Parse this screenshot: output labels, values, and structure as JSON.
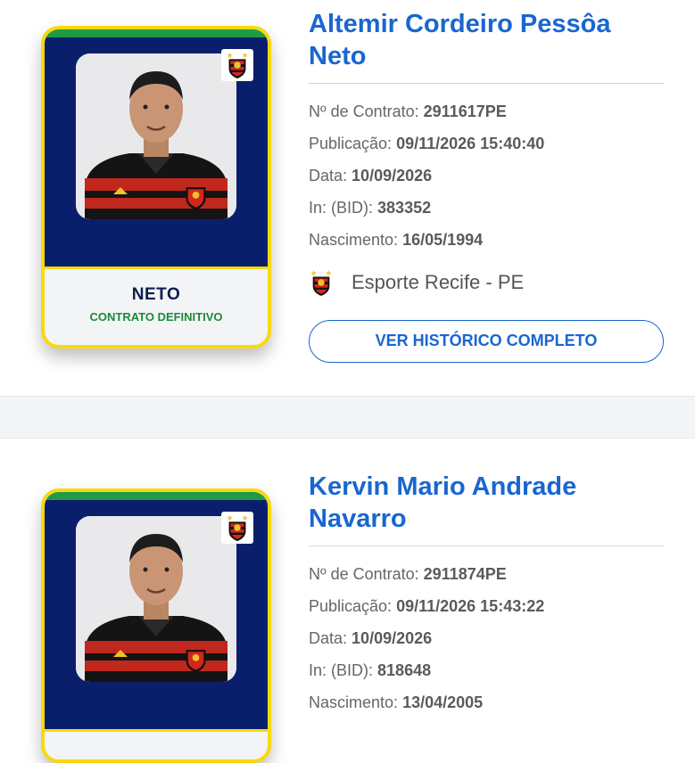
{
  "players": [
    {
      "full_name_line1": "Altemir Cordeiro Pessôa",
      "full_name_line2": "Neto",
      "nickname": "NETO",
      "contract_type": "CONTRATO DEFINITIVO",
      "contract_label": "Nº de Contrato:",
      "contract_value": "2911617PE",
      "publication_label": "Publicação:",
      "publication_value": "09/11/2026 15:40:40",
      "date_label": "Data:",
      "date_value": "10/09/2026",
      "bid_label": "In: (BID):",
      "bid_value": "383352",
      "birth_label": "Nascimento:",
      "birth_value": "16/05/1994",
      "club": "Esporte Recife - PE",
      "history_button": "VER HISTÓRICO COMPLETO"
    },
    {
      "full_name_line1": "Kervin Mario Andrade",
      "full_name_line2": "Navarro",
      "contract_label": "Nº de Contrato:",
      "contract_value": "2911874PE",
      "publication_label": "Publicação:",
      "publication_value": "09/11/2026 15:43:22",
      "date_label": "Data:",
      "date_value": "10/09/2026",
      "bid_label": "In: (BID):",
      "bid_value": "818648",
      "birth_label": "Nascimento:",
      "birth_value": "13/04/2005"
    }
  ],
  "colors": {
    "accent_blue": "#1a66d0",
    "card_navy": "#0a1f6b",
    "card_yellow": "#f8d90f",
    "card_green": "#1f9a45",
    "contract_green": "#1a8a3a"
  },
  "icons": {
    "club_crest": "sport-recife-crest-icon"
  }
}
